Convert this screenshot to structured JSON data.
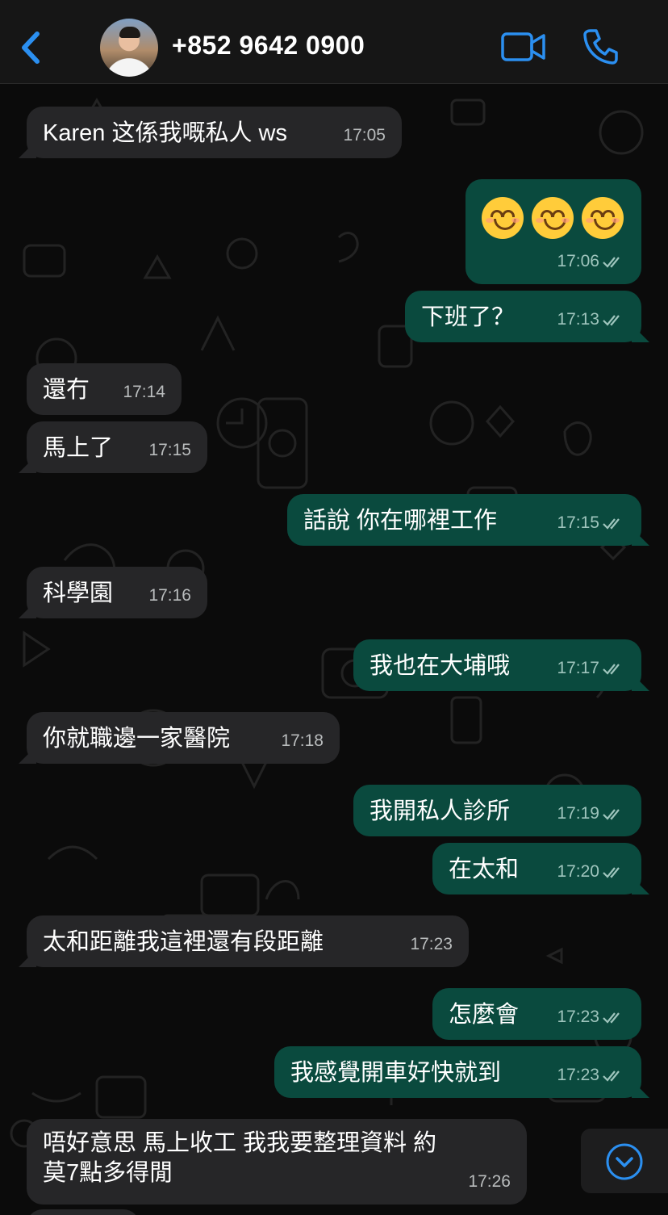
{
  "header": {
    "contact_name": "+852 9642 0900",
    "back_icon": "chevron-left-icon",
    "video_icon": "video-camera-icon",
    "call_icon": "phone-icon",
    "accent_color": "#2b8ff0"
  },
  "messages": [
    {
      "dir": "in",
      "text": "Karen 这係我嘅私人 ws",
      "time": "17:05"
    },
    {
      "dir": "out",
      "text": "",
      "emoji_count": 3,
      "time": "17:06"
    },
    {
      "dir": "out",
      "text": "下班了？",
      "time": "17:13"
    },
    {
      "dir": "in",
      "text": "還冇",
      "time": "17:14"
    },
    {
      "dir": "in",
      "text": "馬上了",
      "time": "17:15"
    },
    {
      "dir": "out",
      "text": "話說  你在哪裡工作",
      "time": "17:15"
    },
    {
      "dir": "in",
      "text": "科學園",
      "time": "17:16"
    },
    {
      "dir": "out",
      "text": "我也在大埔哦",
      "time": "17:17"
    },
    {
      "dir": "in",
      "text": "你就職邊一家醫院",
      "time": "17:18"
    },
    {
      "dir": "out",
      "text": "我開私人診所",
      "time": "17:19"
    },
    {
      "dir": "out",
      "text": "在太和",
      "time": "17:20"
    },
    {
      "dir": "in",
      "text": "太和距離我這裡還有段距離",
      "time": "17:23"
    },
    {
      "dir": "out",
      "text": "怎麼會",
      "time": "17:23"
    },
    {
      "dir": "out",
      "text": "我感覺開車好快就到",
      "time": "17:23"
    },
    {
      "dir": "in",
      "text_line1": "唔好意思 馬上收工 我我要整理資料 約",
      "text_line2": "莫7點多得閒",
      "time": "17:26"
    }
  ],
  "scroll_button_icon": "chevron-down-circle-icon",
  "colors": {
    "incoming_bubble": "#262628",
    "outgoing_bubble": "#0a4a3e",
    "background": "#0b0b0b"
  }
}
